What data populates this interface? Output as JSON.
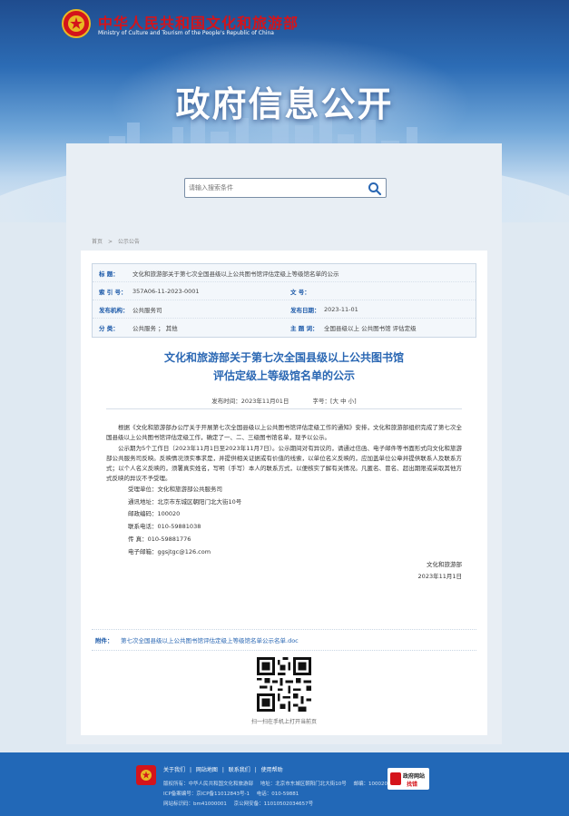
{
  "header": {
    "ministry_cn": "中华人民共和国文化和旅游部",
    "ministry_en": "Ministry of Culture and Tourism of the People's Republic of China",
    "banner_title": "政府信息公开"
  },
  "search": {
    "placeholder": "请输入搜索条件"
  },
  "breadcrumb": [
    "首页",
    ">",
    "公示公告"
  ],
  "meta": {
    "index_label": "索 引 号：",
    "index_value": "357A06-11-2023-0001",
    "topic_label": "索 引 号：",
    "title_label": "标 题：",
    "title_value": "文化和旅游部关于第七次全国县级以上公共图书馆评估定级上等级馆名单的公示",
    "doc_no_label": "发文字号：",
    "doc_no_value": "",
    "publisher_label": "发布机构：",
    "publisher_value": "公共服务司",
    "date_label": "发布日期：",
    "date_value": "2023-11-01",
    "category_label": "分 类：",
    "category_value": "公共服务 ； 其他",
    "subject_label": "主 题 词：",
    "subject_value": "全国县级以上 公共图书馆 评估定级",
    "number_label": "文 号："
  },
  "doc": {
    "title_line1": "文化和旅游部关于第七次全国县级以上公共图书馆",
    "title_line2": "评估定级上等级馆名单的公示",
    "publish_time": "发布时间：2023年11月01日",
    "font_size": "字号：[大 中 小]",
    "para1": "根据《文化和旅游部办公厅关于开展第七次全国县级以上公共图书馆评估定级工作的通知》安排，文化和旅游部组织完成了第七次全国县级以上公共图书馆评估定级工作，确定了一、二、三级图书馆名单，现予以公示。",
    "para2": "公示期为5个工作日（2023年11月1日至2023年11月7日）。公示期间对有异议的，请通过信函、电子邮件等书面形式向文化和旅游部公共服务司反映。反映情况须实事求是，并提供相关证据或有价值的线索，以单位名义反映的，应加盖单位公章并提供联系人及联系方式；以个人名义反映的，须署真实姓名，写明（手写）本人的联系方式，以便核实了解有关情况。凡匿名、冒名、超出期限或采取其他方式反映的异议不予受理。",
    "contact": [
      "受理单位：文化和旅游部公共服务司",
      "通讯地址：北京市东城区朝阳门北大街10号",
      "邮政编码：100020",
      "联系电话：010-59881038",
      "传    真：010-59881776",
      "电子邮箱：ggsjtgc@126.com"
    ],
    "sign_org": "文化和旅游部",
    "sign_date": "2023年11月1日"
  },
  "attachment": {
    "label": "附件：",
    "link": "第七次全国县级以上公共图书馆评估定级上等级馆名单公示名单.doc"
  },
  "qr_caption": "扫一扫在手机上打开当前页",
  "footer": {
    "links": [
      "关于我们",
      "|",
      "网站地图",
      "|",
      "联系我们",
      "|",
      "使用帮助"
    ],
    "line1": [
      "版权所有：中华人民共和国文化和旅游部",
      "地址：北京市东城区朝阳门北大街10号",
      "邮编：100020"
    ],
    "line2": [
      "ICP备案编号：京ICP备11012843号-1",
      "电话：010-59881"
    ],
    "line3": [
      "网站标识码：bm41000001",
      "京公网安备：11010502034657号"
    ],
    "badge_line1": "政府网站",
    "badge_line2": "找错"
  },
  "colors": {
    "accent": "#2a67b3",
    "red": "#d4141b",
    "footer": "#2268b7"
  }
}
